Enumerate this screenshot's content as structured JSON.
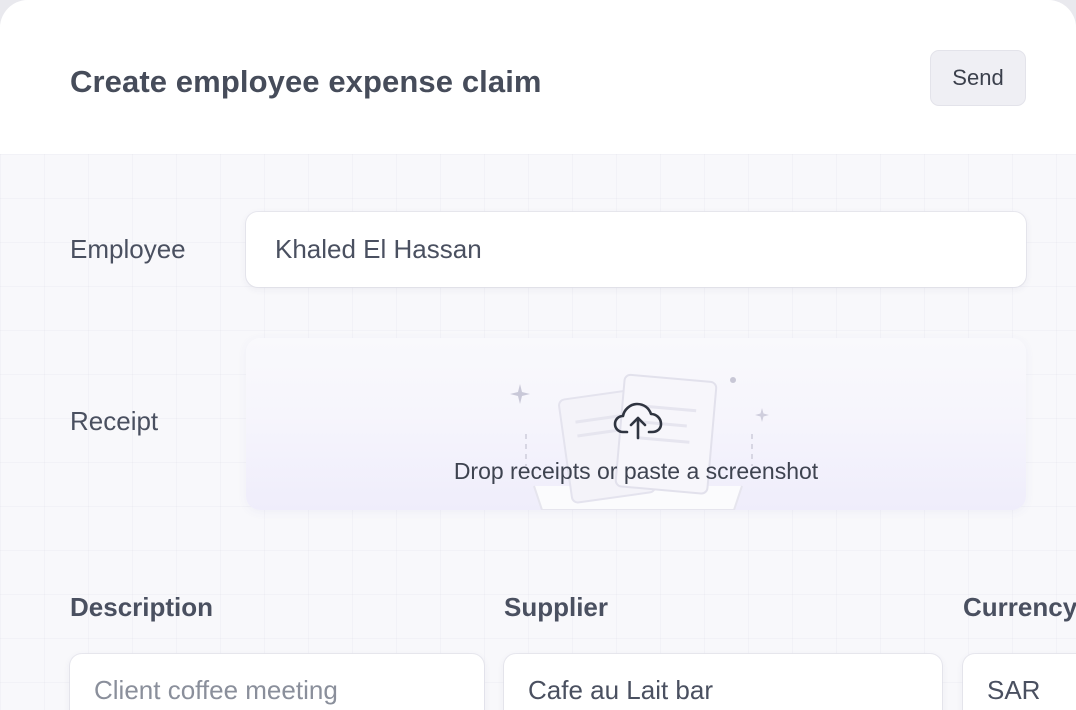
{
  "header": {
    "title": "Create employee expense claim",
    "send_label": "Send"
  },
  "form": {
    "employee": {
      "label": "Employee",
      "value": "Khaled El Hassan"
    },
    "receipt": {
      "label": "Receipt",
      "dropzone_text": "Drop receipts or paste a screenshot",
      "icon": "cloud-upload-icon"
    },
    "description": {
      "label": "Description",
      "placeholder": "Client coffee meeting"
    },
    "supplier": {
      "label": "Supplier",
      "value": "Cafe au Lait bar"
    },
    "currency": {
      "label": "Currency",
      "value": "SAR"
    }
  },
  "colors": {
    "title": "#464c5a",
    "field_bg": "#ffffff",
    "page_bg": "#f8f8fb",
    "dropzone_tint": "#efedfb"
  }
}
